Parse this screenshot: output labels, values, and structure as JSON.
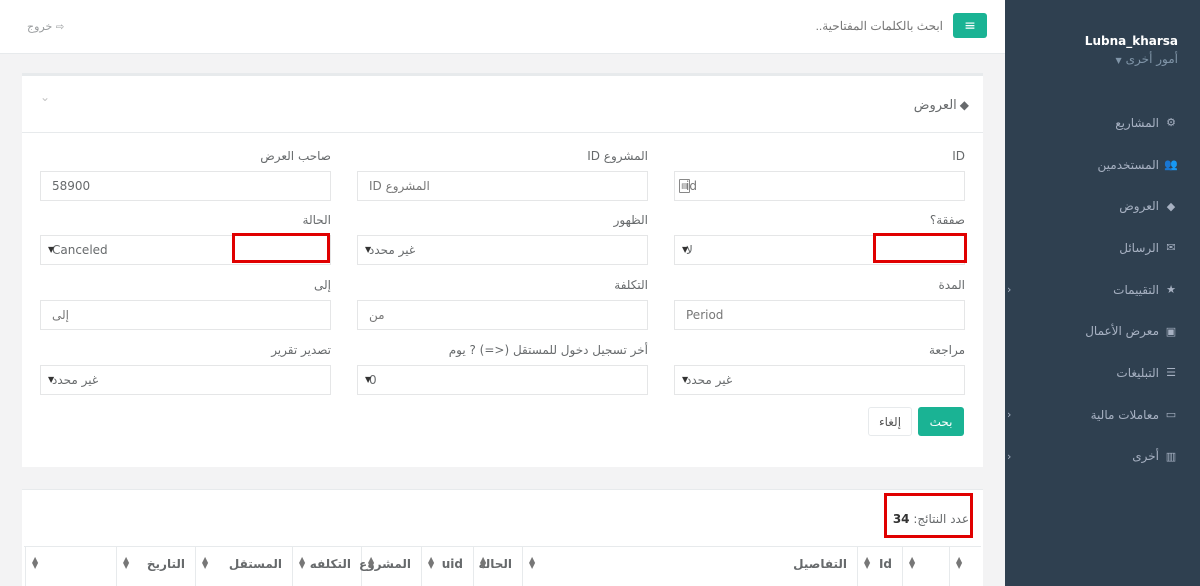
{
  "header": {
    "menu_icon": "bars-icon",
    "search_placeholder": "ابحث بالكلمات المفتاحية..",
    "logout_label": "خروج",
    "logout_icon": "sign-out-icon"
  },
  "sidebar": {
    "username": "Lubna_kharsa",
    "role": "أمور أخرى",
    "items": [
      {
        "label": "المشاريع",
        "icon": "cubes-icon",
        "glyph": "⚙",
        "arrow": ""
      },
      {
        "label": "المستخدمين",
        "icon": "users-icon",
        "glyph": "👥",
        "arrow": ""
      },
      {
        "label": "العروض",
        "icon": "tag-icon",
        "glyph": "◆",
        "arrow": ""
      },
      {
        "label": "الرسائل",
        "icon": "envelope-icon",
        "glyph": "✉",
        "arrow": ""
      },
      {
        "label": "التقييمات",
        "icon": "star-icon",
        "glyph": "★",
        "arrow": "‹"
      },
      {
        "label": "معرض الأعمال",
        "icon": "briefcase-icon",
        "glyph": "▣",
        "arrow": ""
      },
      {
        "label": "التبليغات",
        "icon": "list-icon",
        "glyph": "☰",
        "arrow": ""
      },
      {
        "label": "معاملات مالية",
        "icon": "money-icon",
        "glyph": "▭",
        "arrow": "‹"
      },
      {
        "label": "أخرى",
        "icon": "building-icon",
        "glyph": "▥",
        "arrow": "‹"
      }
    ]
  },
  "panel": {
    "title": "العروض",
    "title_icon": "tag-icon"
  },
  "filters": {
    "id": {
      "label": "ID",
      "placeholder": "id"
    },
    "project_id": {
      "label": "المشروع ID",
      "placeholder": "المشروع ID"
    },
    "offer_owner": {
      "label": "صاحب العرض",
      "value": "58900"
    },
    "deal": {
      "label": "صفقة؟",
      "value": "لا"
    },
    "visibility": {
      "label": "الظهور",
      "value": "غير محدد"
    },
    "status": {
      "label": "الحالة",
      "value": "Canceled"
    },
    "duration": {
      "label": "المدة",
      "placeholder": "Period"
    },
    "cost": {
      "label": "التكلفة",
      "placeholder": "من"
    },
    "to": {
      "label": "إلى",
      "placeholder": "إلى"
    },
    "review": {
      "label": "مراجعة",
      "value": "غير محدد"
    },
    "last_login": {
      "label": "أخر تسجيل دخول للمستقل (<=) ? يوم",
      "value": "0"
    },
    "export": {
      "label": "تصدير تقرير",
      "value": "غير محدد"
    }
  },
  "buttons": {
    "search": "بحث",
    "cancel": "إلغاء"
  },
  "results": {
    "count_label": "عدد النتائج:",
    "count_value": "34",
    "columns": [
      "",
      "",
      "Id",
      "التفاصيل",
      "الحالة",
      "uid",
      "المشروع",
      "التكلفه",
      "المستقل",
      "التاريخ",
      ""
    ]
  },
  "colors": {
    "accent": "#1ab394",
    "sidebar_bg": "#2f4050",
    "highlight": "#e00000"
  }
}
